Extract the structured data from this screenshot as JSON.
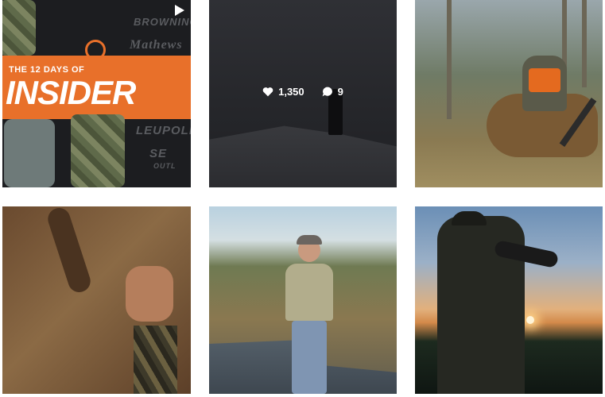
{
  "grid": {
    "tiles": [
      {
        "id": "promo",
        "overlay_text": {
          "subtitle": "THE 12 DAYS OF",
          "title": "INSIDER"
        },
        "brands": [
          "BROWNING",
          "Mathews",
          "LEUPOLD",
          "SE",
          "OUTL"
        ],
        "icon": "video-play-icon"
      },
      {
        "id": "dusk-hunter",
        "hover_stats": {
          "likes": "1,350",
          "comments": "9"
        },
        "icons": [
          "heart-icon",
          "comment-bubble-icon"
        ]
      },
      {
        "id": "elk-hunter"
      },
      {
        "id": "antler-closeup"
      },
      {
        "id": "creek-speaker"
      },
      {
        "id": "sunset-glassing"
      }
    ]
  },
  "colors": {
    "accent_orange": "#e8702a",
    "overlay_text": "#ffffff"
  }
}
